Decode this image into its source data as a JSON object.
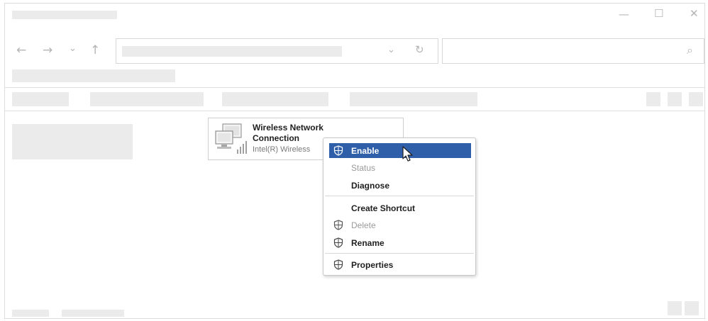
{
  "window": {
    "controls": {
      "minimize": "—",
      "maximize": "☐",
      "close": "✕"
    }
  },
  "nav": {
    "back": "←",
    "forward": "→",
    "recent": "⌄",
    "up": "↑",
    "dropdown": "⌄",
    "refresh": "↻",
    "search_icon": "⌕"
  },
  "tile": {
    "title": "Wireless Network Connection",
    "subtitle": "Intel(R) Wireless",
    "icon": "network-computer-icon",
    "signal_icon": "signal-bars-icon"
  },
  "context_menu": {
    "items": [
      {
        "label": "Enable",
        "icon": "shield-icon",
        "highlighted": true,
        "disabled": false
      },
      {
        "label": "Status",
        "icon": "",
        "highlighted": false,
        "disabled": true
      },
      {
        "label": "Diagnose",
        "icon": "",
        "highlighted": false,
        "disabled": false
      },
      {
        "label": "Create Shortcut",
        "icon": "",
        "highlighted": false,
        "disabled": false
      },
      {
        "label": "Delete",
        "icon": "shield-icon",
        "highlighted": false,
        "disabled": true
      },
      {
        "label": "Rename",
        "icon": "shield-icon",
        "highlighted": false,
        "disabled": false
      },
      {
        "label": "Properties",
        "icon": "shield-icon",
        "highlighted": false,
        "disabled": false
      }
    ]
  },
  "colors": {
    "highlight": "#2e5fa8",
    "placeholder": "#ebebeb",
    "disabled_text": "#9a9a9a"
  }
}
